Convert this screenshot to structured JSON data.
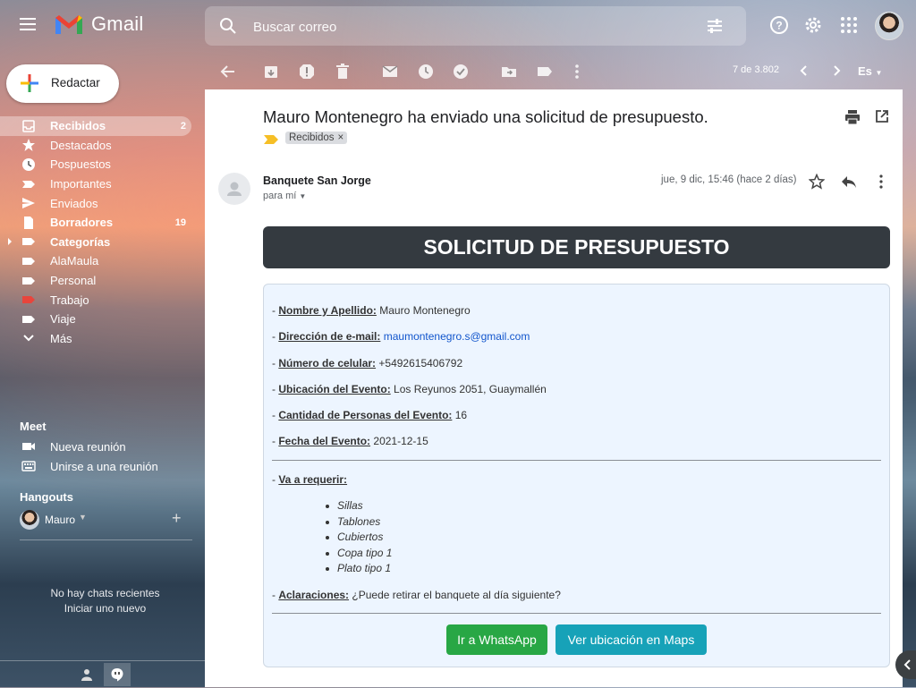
{
  "header": {
    "app_name": "Gmail",
    "search_placeholder": "Buscar correo"
  },
  "compose": {
    "label": "Redactar"
  },
  "nav": {
    "items": [
      {
        "label": "Recibidos",
        "count": "2",
        "icon": "inbox-icon"
      },
      {
        "label": "Destacados",
        "count": "",
        "icon": "star-icon"
      },
      {
        "label": "Pospuestos",
        "count": "",
        "icon": "clock-icon"
      },
      {
        "label": "Importantes",
        "count": "",
        "icon": "important-icon"
      },
      {
        "label": "Enviados",
        "count": "",
        "icon": "send-icon"
      },
      {
        "label": "Borradores",
        "count": "19",
        "icon": "draft-icon"
      },
      {
        "label": "Categorías",
        "count": "",
        "icon": "label-icon"
      },
      {
        "label": "AlaMaula",
        "count": "",
        "icon": "label-icon"
      },
      {
        "label": "Personal",
        "count": "",
        "icon": "label-icon"
      },
      {
        "label": "Trabajo",
        "count": "",
        "icon": "label-icon",
        "color": "#e8453c"
      },
      {
        "label": "Viaje",
        "count": "",
        "icon": "label-icon"
      },
      {
        "label": "Más",
        "count": "",
        "icon": "chevron-down-icon"
      }
    ]
  },
  "meet": {
    "title": "Meet",
    "new_meeting": "Nueva reunión",
    "join_meeting": "Unirse a una reunión"
  },
  "hangouts": {
    "title": "Hangouts",
    "user": "Mauro",
    "no_chats": "No hay chats recientes",
    "start_new": "Iniciar uno nuevo"
  },
  "toolbar": {
    "pager": "7 de 3.802",
    "lang": "Es"
  },
  "email": {
    "subject": "Mauro Montenegro ha enviado una solicitud de presupuesto.",
    "label_chip": "Recibidos",
    "sender": "Banquete San Jorge",
    "to": "para mí",
    "date": "jue, 9 dic, 15:46 (hace 2 días)",
    "banner": "SOLICITUD DE PRESUPUESTO",
    "fields": [
      {
        "label": "Nombre y Apellido:",
        "value": "Mauro Montenegro"
      },
      {
        "label": "Dirección de e-mail:",
        "value": "maumontenegro.s@gmail.com",
        "link": true
      },
      {
        "label": "Número de celular:",
        "value": "+5492615406792"
      },
      {
        "label": "Ubicación del Evento:",
        "value": "Los Reyunos 2051, Guaymallén"
      },
      {
        "label": "Cantidad de Personas del Evento:",
        "value": "16"
      },
      {
        "label": "Fecha del Evento:",
        "value": "2021-12-15"
      }
    ],
    "requires_label": "Va a requerir:",
    "items": [
      "Sillas",
      "Tablones",
      "Cubiertos",
      "Copa tipo 1",
      "Plato tipo 1"
    ],
    "notes_label": "Aclaraciones:",
    "notes_value": "¿Puede retirar el banquete al día siguiente?",
    "btn_whatsapp": "Ir a WhatsApp",
    "btn_maps": "Ver ubicación en Maps",
    "colors": {
      "banner": "#343a40",
      "whatsapp": "#28a745",
      "maps": "#17a2b8",
      "card": "#edf5ff"
    }
  }
}
